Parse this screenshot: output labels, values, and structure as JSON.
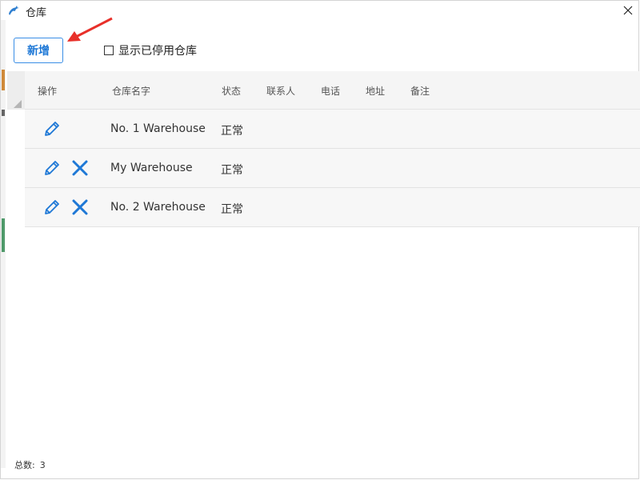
{
  "window": {
    "title": "仓库"
  },
  "toolbar": {
    "add_label": "新增",
    "show_disabled_label": "显示已停用仓库",
    "show_disabled_checked": false
  },
  "table": {
    "columns": [
      "操作",
      "仓库名字",
      "状态",
      "联系人",
      "电话",
      "地址",
      "备注"
    ],
    "rows": [
      {
        "name": "No. 1 Warehouse",
        "status": "正常",
        "contact": "",
        "phone": "",
        "address": "",
        "remark": "",
        "actions": [
          "edit"
        ]
      },
      {
        "name": "My Warehouse",
        "status": "正常",
        "contact": "",
        "phone": "",
        "address": "",
        "remark": "",
        "actions": [
          "edit",
          "delete"
        ]
      },
      {
        "name": "No. 2 Warehouse",
        "status": "正常",
        "contact": "",
        "phone": "",
        "address": "",
        "remark": "",
        "actions": [
          "edit",
          "delete"
        ]
      }
    ]
  },
  "footer": {
    "total_label": "总数:",
    "total_value": "3"
  },
  "colors": {
    "accent": "#1e78d6",
    "arrow": "#e8302a",
    "header_bg": "#f5f5f5",
    "row_bg": "#f7f7f7"
  },
  "icons": [
    "dolphin-icon",
    "close-icon",
    "pencil-icon",
    "x-icon",
    "red-arrow-icon"
  ]
}
